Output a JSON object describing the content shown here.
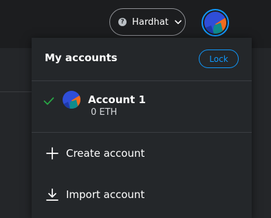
{
  "header": {
    "network": {
      "label": "Hardhat",
      "icon": "question-circle-icon"
    },
    "avatar_icon": "account-avatar-icon"
  },
  "account_menu": {
    "title": "My accounts",
    "lock_label": "Lock",
    "accounts": [
      {
        "name": "Account 1",
        "balance": "0 ETH",
        "selected": true
      }
    ],
    "actions": [
      {
        "label": "Create account",
        "icon": "plus-icon"
      },
      {
        "label": "Import account",
        "icon": "download-icon"
      }
    ]
  },
  "colors": {
    "accent": "#1098fc",
    "check": "#28a745",
    "menu_bg": "#24272a",
    "page_bg": "#1c1d1f"
  }
}
